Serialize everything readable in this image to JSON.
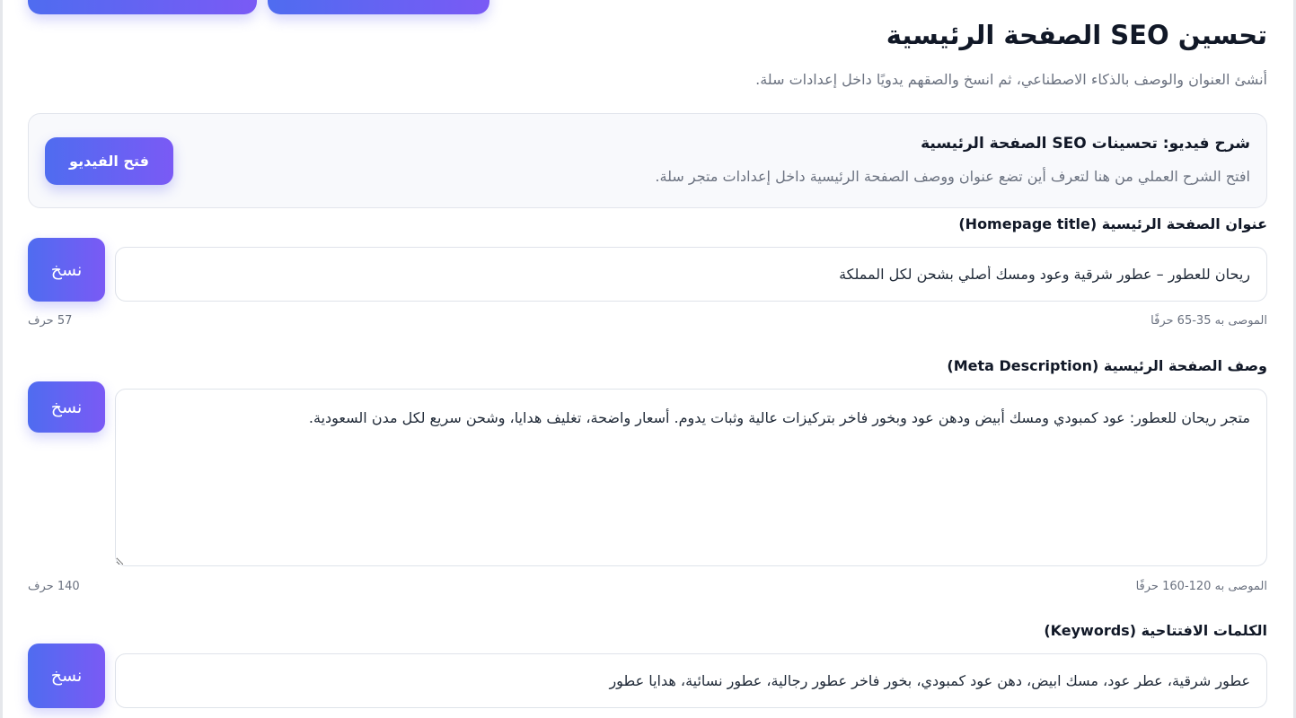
{
  "header": {
    "title": "تحسين SEO الصفحة الرئيسية",
    "subtitle": "أنشئ العنوان والوصف بالذكاء الاصطناعي، ثم انسخ والصقهم يدويًا داخل إعدادات سلة."
  },
  "video": {
    "title": "شرح فيديو: تحسينات SEO الصفحة الرئيسية",
    "description": "افتح الشرح العملي من هنا لتعرف أين تضع عنوان ووصف الصفحة الرئيسية داخل إعدادات متجر سلة.",
    "button_label": "فتح الفيديو"
  },
  "fields": {
    "title": {
      "label": "عنوان الصفحة الرئيسية (Homepage title)",
      "value": "ريحان للعطور – عطور شرقية وعود ومسك أصلي بشحن لكل المملكة",
      "copy_label": "نسخ",
      "hint": "الموصى به 35-65 حرفًا",
      "count": "57 حرف"
    },
    "description": {
      "label": "وصف الصفحة الرئيسية (Meta Description)",
      "value": "متجر ريحان للعطور: عود كمبودي ومسك أبيض ودهن عود وبخور فاخر بتركيزات عالية وثبات يدوم. أسعار واضحة، تغليف هدايا، وشحن سريع لكل مدن السعودية.",
      "copy_label": "نسخ",
      "hint": "الموصى به 120-160 حرفًا",
      "count": "140 حرف"
    },
    "keywords": {
      "label": "الكلمات الافتتاحية (Keywords)",
      "value": "عطور شرقية، عطر عود، مسك ابيض، دهن عود كمبودي، بخور فاخر عطور رجالية، عطور نسائية، هدايا عطور",
      "copy_label": "نسخ"
    }
  }
}
